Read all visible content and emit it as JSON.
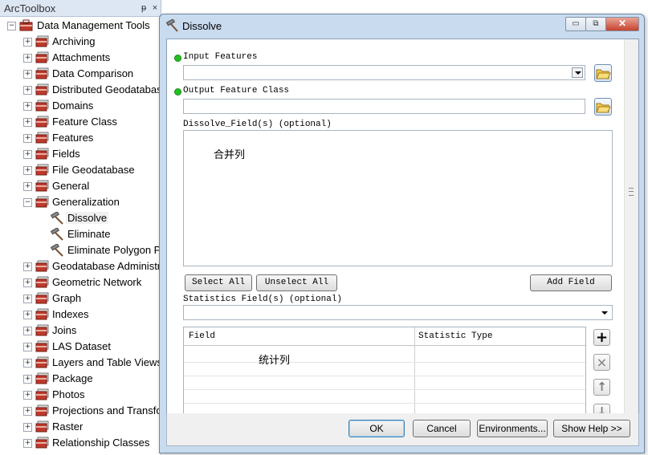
{
  "toolbox": {
    "title": "ArcToolbox",
    "pin_glyph": "ᵽ",
    "close_glyph": "×",
    "root": {
      "label": "Data Management Tools",
      "expanded": true
    },
    "items": [
      {
        "label": "Archiving",
        "type": "toolset",
        "expanded": false
      },
      {
        "label": "Attachments",
        "type": "toolset",
        "expanded": false
      },
      {
        "label": "Data Comparison",
        "type": "toolset",
        "expanded": false
      },
      {
        "label": "Distributed Geodatabase",
        "type": "toolset",
        "expanded": false
      },
      {
        "label": "Domains",
        "type": "toolset",
        "expanded": false
      },
      {
        "label": "Feature Class",
        "type": "toolset",
        "expanded": false
      },
      {
        "label": "Features",
        "type": "toolset",
        "expanded": false
      },
      {
        "label": "Fields",
        "type": "toolset",
        "expanded": false
      },
      {
        "label": "File Geodatabase",
        "type": "toolset",
        "expanded": false
      },
      {
        "label": "General",
        "type": "toolset",
        "expanded": false
      },
      {
        "label": "Generalization",
        "type": "toolset",
        "expanded": true
      },
      {
        "label": "Dissolve",
        "type": "tool",
        "selected": true
      },
      {
        "label": "Eliminate",
        "type": "tool"
      },
      {
        "label": "Eliminate Polygon Part",
        "type": "tool"
      },
      {
        "label": "Geodatabase Administration",
        "type": "toolset",
        "expanded": false
      },
      {
        "label": "Geometric Network",
        "type": "toolset",
        "expanded": false
      },
      {
        "label": "Graph",
        "type": "toolset",
        "expanded": false
      },
      {
        "label": "Indexes",
        "type": "toolset",
        "expanded": false
      },
      {
        "label": "Joins",
        "type": "toolset",
        "expanded": false
      },
      {
        "label": "LAS Dataset",
        "type": "toolset",
        "expanded": false
      },
      {
        "label": "Layers and Table Views",
        "type": "toolset",
        "expanded": false
      },
      {
        "label": "Package",
        "type": "toolset",
        "expanded": false
      },
      {
        "label": "Photos",
        "type": "toolset",
        "expanded": false
      },
      {
        "label": "Projections and Transformations",
        "type": "toolset",
        "expanded": false
      },
      {
        "label": "Raster",
        "type": "toolset",
        "expanded": false
      },
      {
        "label": "Relationship Classes",
        "type": "toolset",
        "expanded": false
      }
    ]
  },
  "dialog": {
    "title": "Dissolve",
    "window_buttons": {
      "minimize": "▭",
      "restore": "⧉",
      "close": "✕"
    },
    "input_features": {
      "label": "Input Features",
      "value": ""
    },
    "output_feature_class": {
      "label": "Output Feature Class",
      "value": ""
    },
    "dissolve_fields": {
      "label": "Dissolve_Field(s) (optional)",
      "annotation": "合并列"
    },
    "buttons": {
      "select_all": "Select All",
      "unselect_all": "Unselect All",
      "add_field": "Add Field"
    },
    "statistics_fields": {
      "label": "Statistics Field(s) (optional)",
      "value": "",
      "columns": [
        "Field",
        "Statistic Type"
      ],
      "annotation": "统计列"
    },
    "side_buttons": {
      "add": "+",
      "remove": "×",
      "up": "↑",
      "down": "↓"
    },
    "footer": {
      "ok": "OK",
      "cancel": "Cancel",
      "environments": "Environments...",
      "show_help": "Show Help >>"
    }
  },
  "colors": {
    "required_dot": "#22c020",
    "dialog_frame": "#c9dbee",
    "toolbox_header": "#dde7f3"
  }
}
